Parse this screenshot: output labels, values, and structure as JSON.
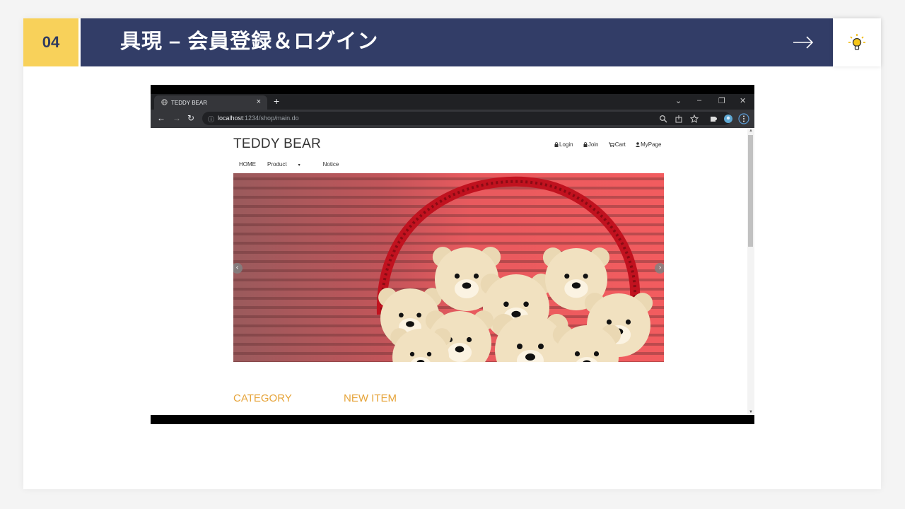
{
  "slide": {
    "number": "04",
    "title": "具現 – 会員登録＆ログイン",
    "icons": [
      "arrow-right-icon",
      "lightbulb-icon"
    ],
    "colors": {
      "number_bg": "#f8d15a",
      "title_bg": "#323d67"
    }
  },
  "browser": {
    "tab_title": "TEDDY BEAR",
    "new_tab": "+",
    "tab_close": "×",
    "url_host": "localhost",
    "url_path": ":1234/shop/main.do",
    "window_controls": [
      "⌄",
      "–",
      "❐",
      "✕"
    ]
  },
  "site": {
    "brand": "TEDDY BEAR",
    "top_links": [
      "Login",
      "Join",
      "Cart",
      "MyPage"
    ],
    "menu": [
      "HOME",
      "Product",
      "Notice"
    ],
    "sections": [
      "CATEGORY",
      "NEW ITEM"
    ],
    "carousel_prev": "‹",
    "carousel_next": "›",
    "accent_color": "#e6a43a"
  }
}
